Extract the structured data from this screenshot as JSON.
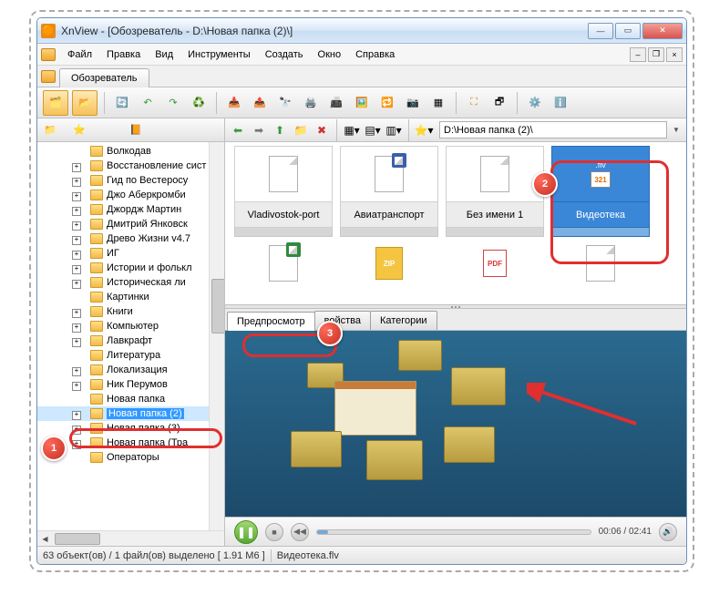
{
  "window": {
    "title": "XnView - [Обозреватель - D:\\Новая папка (2)\\]"
  },
  "menu": {
    "file": "Файл",
    "edit": "Правка",
    "view": "Вид",
    "tools": "Инструменты",
    "create": "Создать",
    "window": "Окно",
    "help": "Справка"
  },
  "tab": {
    "browser": "Обозреватель"
  },
  "address": {
    "path": "D:\\Новая папка (2)\\"
  },
  "tree": {
    "items": [
      {
        "label": "Волкодав",
        "expand": "none"
      },
      {
        "label": "Восстановление сист",
        "expand": "plus"
      },
      {
        "label": "Гид по Вестеросу",
        "expand": "plus"
      },
      {
        "label": "Джо Аберкромби",
        "expand": "plus"
      },
      {
        "label": "Джордж Мартин",
        "expand": "plus"
      },
      {
        "label": "Дмитрий Янковск",
        "expand": "plus"
      },
      {
        "label": "Древо Жизни v4.7",
        "expand": "plus"
      },
      {
        "label": "ИГ",
        "expand": "plus"
      },
      {
        "label": "Истории и фолькл",
        "expand": "plus"
      },
      {
        "label": "Историческая ли",
        "expand": "plus"
      },
      {
        "label": "Картинки",
        "expand": "none"
      },
      {
        "label": "Книги",
        "expand": "plus"
      },
      {
        "label": "Компьютер",
        "expand": "plus"
      },
      {
        "label": "Лавкрафт",
        "expand": "plus"
      },
      {
        "label": "Литература",
        "expand": "none"
      },
      {
        "label": "Локализация",
        "expand": "plus"
      },
      {
        "label": "Ник Перумов",
        "expand": "plus"
      },
      {
        "label": "Новая папка",
        "expand": "none"
      },
      {
        "label": "Новая папка (2)",
        "expand": "plus",
        "selected": true
      },
      {
        "label": "Новая папка (3)",
        "expand": "plus"
      },
      {
        "label": "Новая папка (Тра",
        "expand": "plus"
      },
      {
        "label": "Операторы",
        "expand": "none"
      }
    ]
  },
  "thumbs": [
    {
      "label": "Vladivostok-port",
      "type": "doc"
    },
    {
      "label": "Авиатранспорт",
      "type": "word"
    },
    {
      "label": "Без имени 1",
      "type": "blank"
    },
    {
      "label": "Видеотека",
      "type": "flv",
      "selected": true,
      "badge": ".flv",
      "mpc": "321"
    }
  ],
  "thumbs2": [
    {
      "type": "excel"
    },
    {
      "type": "zip",
      "text": "ZIP"
    },
    {
      "type": "pdf",
      "text": "PDF"
    },
    {
      "type": "doc"
    }
  ],
  "panel_tabs": {
    "preview": "Предпросмотр",
    "properties": "войства",
    "categories": "Категории"
  },
  "player": {
    "time": "00:06 / 02:41"
  },
  "status": {
    "left": "63 объект(ов) / 1 файл(ов) выделено  [ 1.91 М6 ]",
    "file": "Видеотека.flv"
  },
  "callouts": {
    "c1": "1",
    "c2": "2",
    "c3": "3"
  }
}
